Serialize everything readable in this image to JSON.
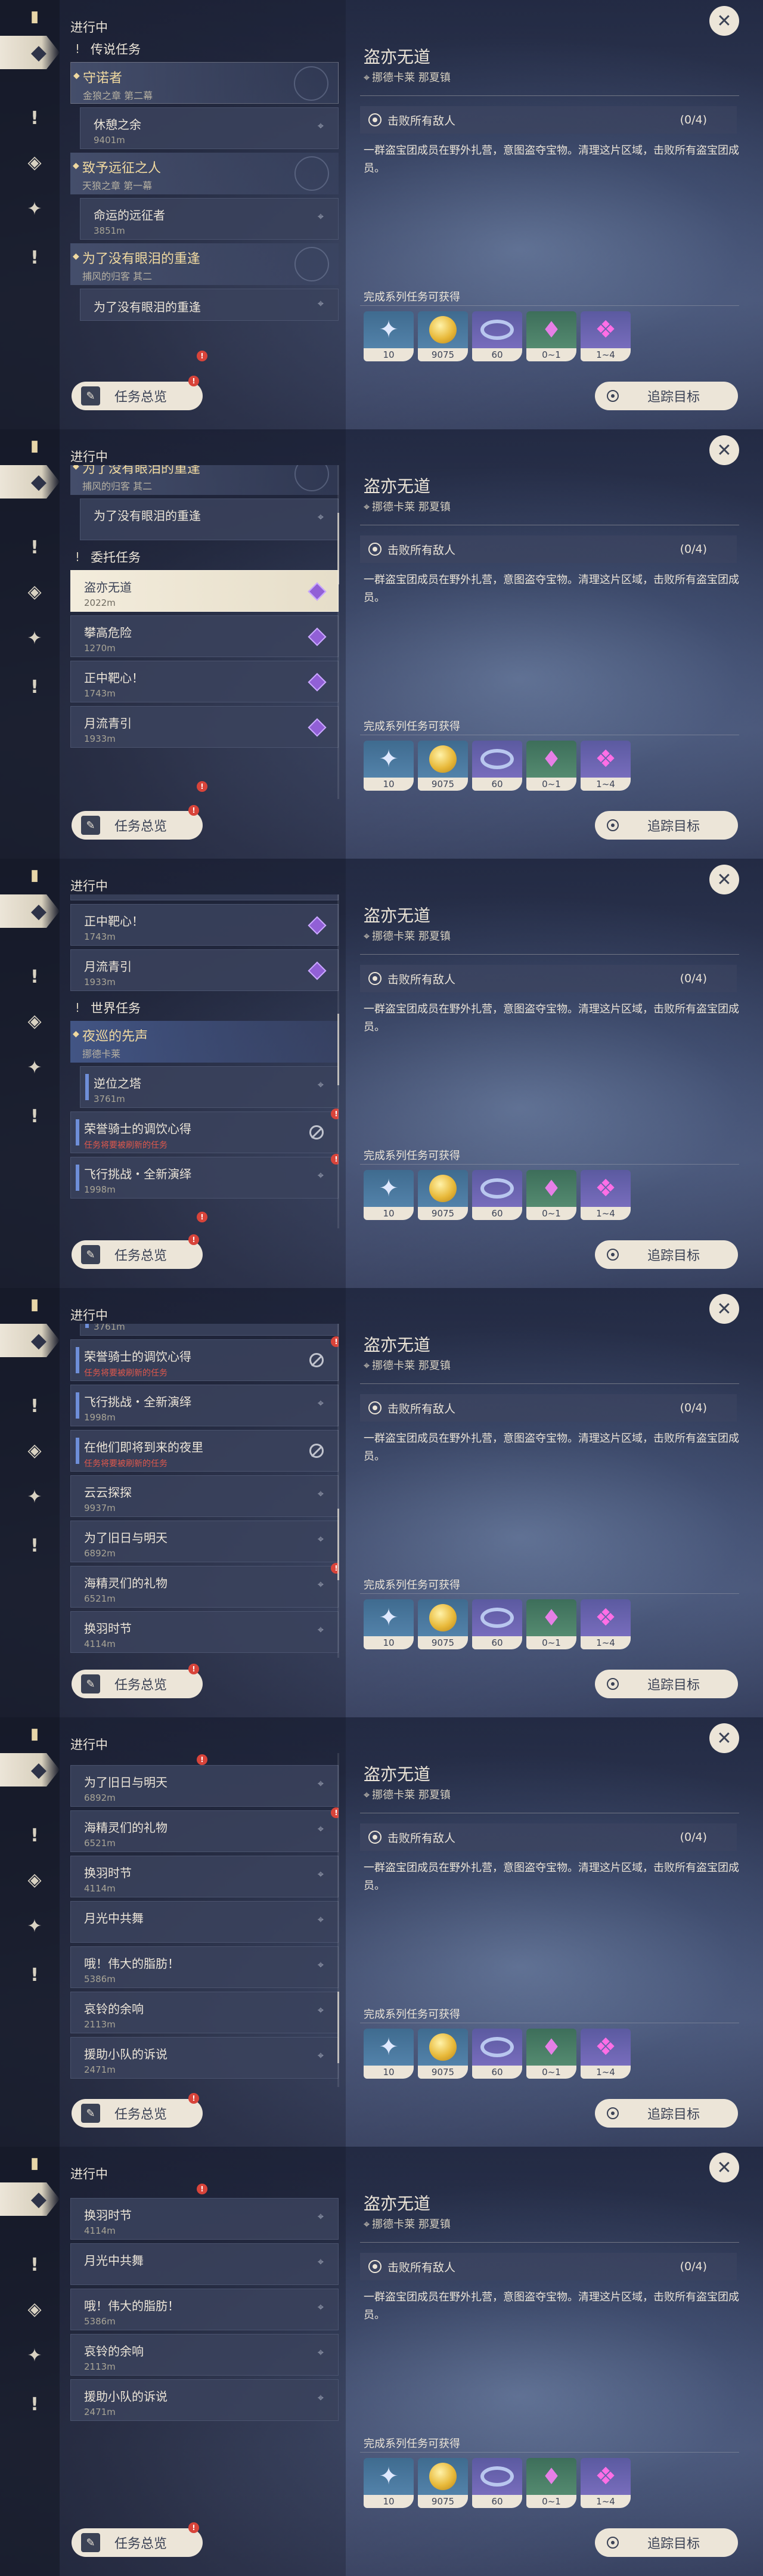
{
  "shared": {
    "header_title": "进行中",
    "detail": {
      "title": "盗亦无道",
      "location": "挪德卡莱 那夏镇",
      "objective": "击败所有敌人",
      "objective_count": "(0/4)",
      "description": "一群盗宝团成员在野外扎营，意图盗夺宝物。清理这片区域，击败所有盗宝团成员。",
      "reward_title": "完成系列任务可获得",
      "rewards": [
        {
          "icon": "adventure-exp-icon",
          "value": "10"
        },
        {
          "icon": "mora-icon",
          "value": "9075"
        },
        {
          "icon": "companionship-exp-icon",
          "value": "60"
        },
        {
          "icon": "crystal-icon",
          "value": "0~1"
        },
        {
          "icon": "crystal-cluster-icon",
          "value": "1~4"
        }
      ]
    },
    "overview_button": "任务总览",
    "track_button": "追踪目标",
    "close_icon": "close-icon",
    "badge": "!"
  },
  "groups": {
    "legend": "传说任务",
    "commission": "委托任务",
    "world": "世界任务"
  },
  "quests": {
    "legend_1": {
      "title": "守诺者",
      "sub": "金狼之章 第二幕"
    },
    "legend_1_step": {
      "title": "休憩之余",
      "dist": "9401m"
    },
    "legend_2": {
      "title": "致予远征之人",
      "sub": "天狼之章 第一幕"
    },
    "legend_2_step": {
      "title": "命运的远征者",
      "dist": "3851m"
    },
    "legend_3": {
      "title": "为了没有眼泪的重逢",
      "sub": "捕风的归客 其二"
    },
    "legend_3_step": {
      "title": "为了没有眼泪的重逢"
    },
    "daily_1": {
      "title": "盗亦无道",
      "dist": "2022m"
    },
    "daily_2": {
      "title": "攀高危险",
      "dist": "1270m"
    },
    "daily_3": {
      "title": "正中靶心！",
      "dist": "1743m"
    },
    "daily_4": {
      "title": "月流青引",
      "dist": "1933m"
    },
    "world_1": {
      "title": "夜巡的先声",
      "sub": "挪德卡莱"
    },
    "world_1_step": {
      "title": "逆位之塔",
      "dist": "3761m"
    },
    "world_2": {
      "title": "荣誉骑士的调饮心得",
      "red": "任务将要被刷新的任务"
    },
    "world_3": {
      "title": "飞行挑战・全新演绎",
      "dist": "1998m"
    },
    "world_4": {
      "title": "在他们即将到来的夜里",
      "red": "任务将要被刷新的任务"
    },
    "world_5": {
      "title": "云云探探",
      "dist": "9937m"
    },
    "world_6": {
      "title": "为了旧日与明天",
      "dist": "6892m"
    },
    "world_7": {
      "title": "海精灵们的礼物",
      "dist": "6521m"
    },
    "world_8": {
      "title": "换羽时节",
      "dist": "4114m"
    },
    "world_9": {
      "title": "月光中共舞",
      "dist": ""
    },
    "world_10": {
      "title": "哦！伟大的脂肪！",
      "dist": "5386m"
    },
    "world_11": {
      "title": "哀铃的余响",
      "dist": "2113m"
    },
    "world_12": {
      "title": "援助小队的诉说",
      "dist": "2471m"
    }
  },
  "rail_icons": [
    "quest-book-icon",
    "quest-diamond-icon",
    "exclamation-icon",
    "diamond-icon",
    "exclamation-icon"
  ]
}
